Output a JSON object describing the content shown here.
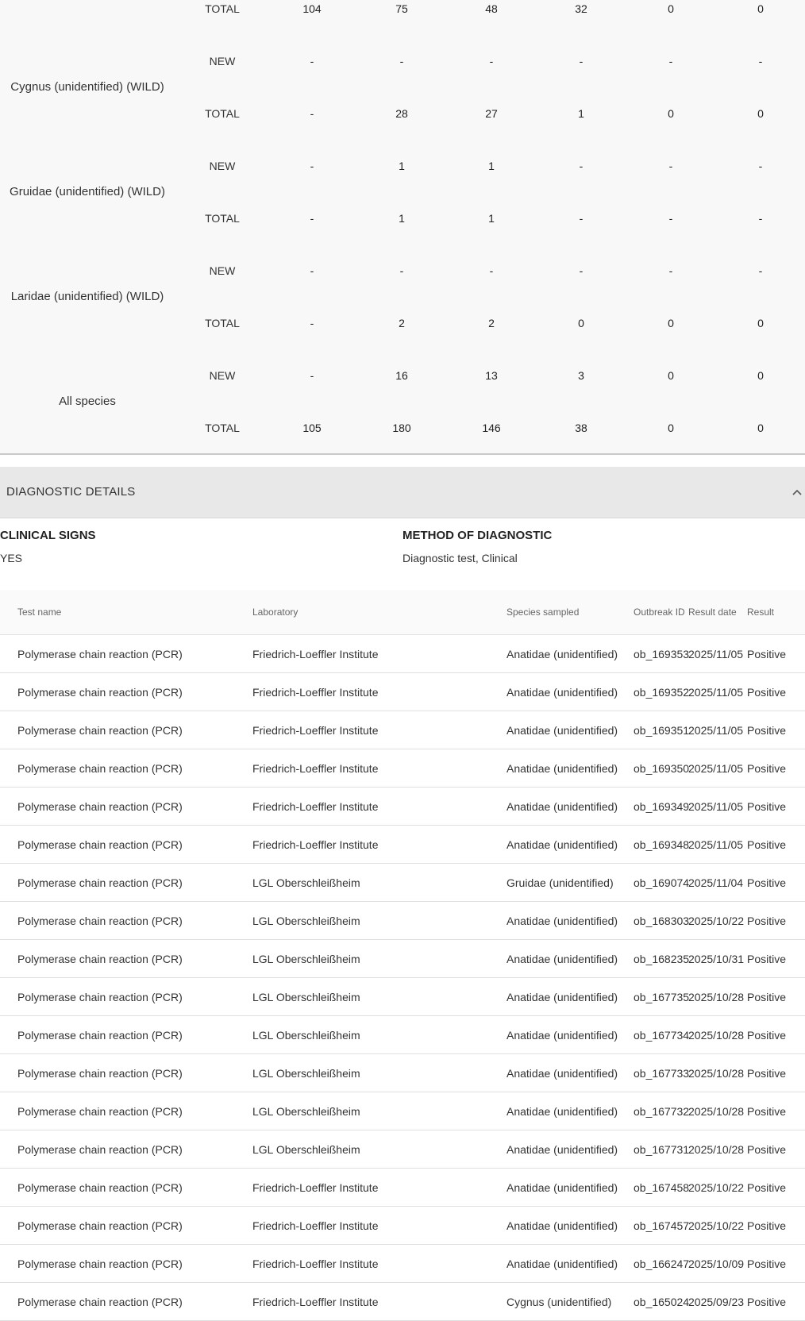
{
  "summary": {
    "rows": [
      {
        "species": "",
        "type": "TOTAL",
        "values": [
          "104",
          "75",
          "48",
          "32",
          "0",
          "0"
        ]
      },
      {
        "species": "Cygnus (unidentified) (WILD)",
        "type": "NEW",
        "values": [
          "-",
          "-",
          "-",
          "-",
          "-",
          "-"
        ]
      },
      {
        "species": "",
        "type": "TOTAL",
        "values": [
          "-",
          "28",
          "27",
          "1",
          "0",
          "0"
        ]
      },
      {
        "species": "Gruidae (unidentified) (WILD)",
        "type": "NEW",
        "values": [
          "-",
          "1",
          "1",
          "-",
          "-",
          "-"
        ]
      },
      {
        "species": "",
        "type": "TOTAL",
        "values": [
          "-",
          "1",
          "1",
          "-",
          "-",
          "-"
        ]
      },
      {
        "species": "Laridae (unidentified) (WILD)",
        "type": "NEW",
        "values": [
          "-",
          "-",
          "-",
          "-",
          "-",
          "-"
        ]
      },
      {
        "species": "",
        "type": "TOTAL",
        "values": [
          "-",
          "2",
          "2",
          "0",
          "0",
          "0"
        ]
      },
      {
        "species": "All species",
        "type": "NEW",
        "values": [
          "-",
          "16",
          "13",
          "3",
          "0",
          "0"
        ]
      },
      {
        "species": "",
        "type": "TOTAL",
        "values": [
          "105",
          "180",
          "146",
          "38",
          "0",
          "0"
        ]
      }
    ]
  },
  "diagnostic": {
    "section_title": "DIAGNOSTIC DETAILS",
    "clinical_signs_label": "CLINICAL SIGNS",
    "clinical_signs_value": "YES",
    "method_label": "METHOD OF DIAGNOSTIC",
    "method_value": "Diagnostic test, Clinical"
  },
  "tests": {
    "headers": {
      "test": "Test name",
      "lab": "Laboratory",
      "species": "Species sampled",
      "outbreak": "Outbreak ID",
      "date": "Result date",
      "result": "Result"
    },
    "rows": [
      {
        "test": "Polymerase chain reaction (PCR)",
        "lab": "Friedrich-Loeffler Institute",
        "species": "Anatidae (unidentified)",
        "outbreak": "ob_169353",
        "date": "2025/11/05",
        "result": "Positive"
      },
      {
        "test": "Polymerase chain reaction (PCR)",
        "lab": "Friedrich-Loeffler Institute",
        "species": "Anatidae (unidentified)",
        "outbreak": "ob_169352",
        "date": "2025/11/05",
        "result": "Positive"
      },
      {
        "test": "Polymerase chain reaction (PCR)",
        "lab": "Friedrich-Loeffler Institute",
        "species": "Anatidae (unidentified)",
        "outbreak": "ob_169351",
        "date": "2025/11/05",
        "result": "Positive"
      },
      {
        "test": "Polymerase chain reaction (PCR)",
        "lab": "Friedrich-Loeffler Institute",
        "species": "Anatidae (unidentified)",
        "outbreak": "ob_169350",
        "date": "2025/11/05",
        "result": "Positive"
      },
      {
        "test": "Polymerase chain reaction (PCR)",
        "lab": "Friedrich-Loeffler Institute",
        "species": "Anatidae (unidentified)",
        "outbreak": "ob_169349",
        "date": "2025/11/05",
        "result": "Positive"
      },
      {
        "test": "Polymerase chain reaction (PCR)",
        "lab": "Friedrich-Loeffler Institute",
        "species": "Anatidae (unidentified)",
        "outbreak": "ob_169348",
        "date": "2025/11/05",
        "result": "Positive"
      },
      {
        "test": "Polymerase chain reaction (PCR)",
        "lab": "LGL Oberschleißheim",
        "species": "Gruidae (unidentified)",
        "outbreak": "ob_169074",
        "date": "2025/11/04",
        "result": "Positive"
      },
      {
        "test": "Polymerase chain reaction (PCR)",
        "lab": "LGL Oberschleißheim",
        "species": "Anatidae (unidentified)",
        "outbreak": "ob_168303",
        "date": "2025/10/22",
        "result": "Positive"
      },
      {
        "test": "Polymerase chain reaction (PCR)",
        "lab": "LGL Oberschleißheim",
        "species": "Anatidae (unidentified)",
        "outbreak": "ob_168235",
        "date": "2025/10/31",
        "result": "Positive"
      },
      {
        "test": "Polymerase chain reaction (PCR)",
        "lab": "LGL Oberschleißheim",
        "species": "Anatidae (unidentified)",
        "outbreak": "ob_167735",
        "date": "2025/10/28",
        "result": "Positive"
      },
      {
        "test": "Polymerase chain reaction (PCR)",
        "lab": "LGL Oberschleißheim",
        "species": "Anatidae (unidentified)",
        "outbreak": "ob_167734",
        "date": "2025/10/28",
        "result": "Positive"
      },
      {
        "test": "Polymerase chain reaction (PCR)",
        "lab": "LGL Oberschleißheim",
        "species": "Anatidae (unidentified)",
        "outbreak": "ob_167733",
        "date": "2025/10/28",
        "result": "Positive"
      },
      {
        "test": "Polymerase chain reaction (PCR)",
        "lab": "LGL Oberschleißheim",
        "species": "Anatidae (unidentified)",
        "outbreak": "ob_167732",
        "date": "2025/10/28",
        "result": "Positive"
      },
      {
        "test": "Polymerase chain reaction (PCR)",
        "lab": "LGL Oberschleißheim",
        "species": "Anatidae (unidentified)",
        "outbreak": "ob_167731",
        "date": "2025/10/28",
        "result": "Positive"
      },
      {
        "test": "Polymerase chain reaction (PCR)",
        "lab": "Friedrich-Loeffler Institute",
        "species": "Anatidae (unidentified)",
        "outbreak": "ob_167458",
        "date": "2025/10/22",
        "result": "Positive"
      },
      {
        "test": "Polymerase chain reaction (PCR)",
        "lab": "Friedrich-Loeffler Institute",
        "species": "Anatidae (unidentified)",
        "outbreak": "ob_167457",
        "date": "2025/10/22",
        "result": "Positive"
      },
      {
        "test": "Polymerase chain reaction (PCR)",
        "lab": "Friedrich-Loeffler Institute",
        "species": "Anatidae (unidentified)",
        "outbreak": "ob_166247",
        "date": "2025/10/09",
        "result": "Positive"
      },
      {
        "test": "Polymerase chain reaction (PCR)",
        "lab": "Friedrich-Loeffler Institute",
        "species": "Cygnus (unidentified)",
        "outbreak": "ob_165024",
        "date": "2025/09/23",
        "result": "Positive"
      }
    ]
  }
}
